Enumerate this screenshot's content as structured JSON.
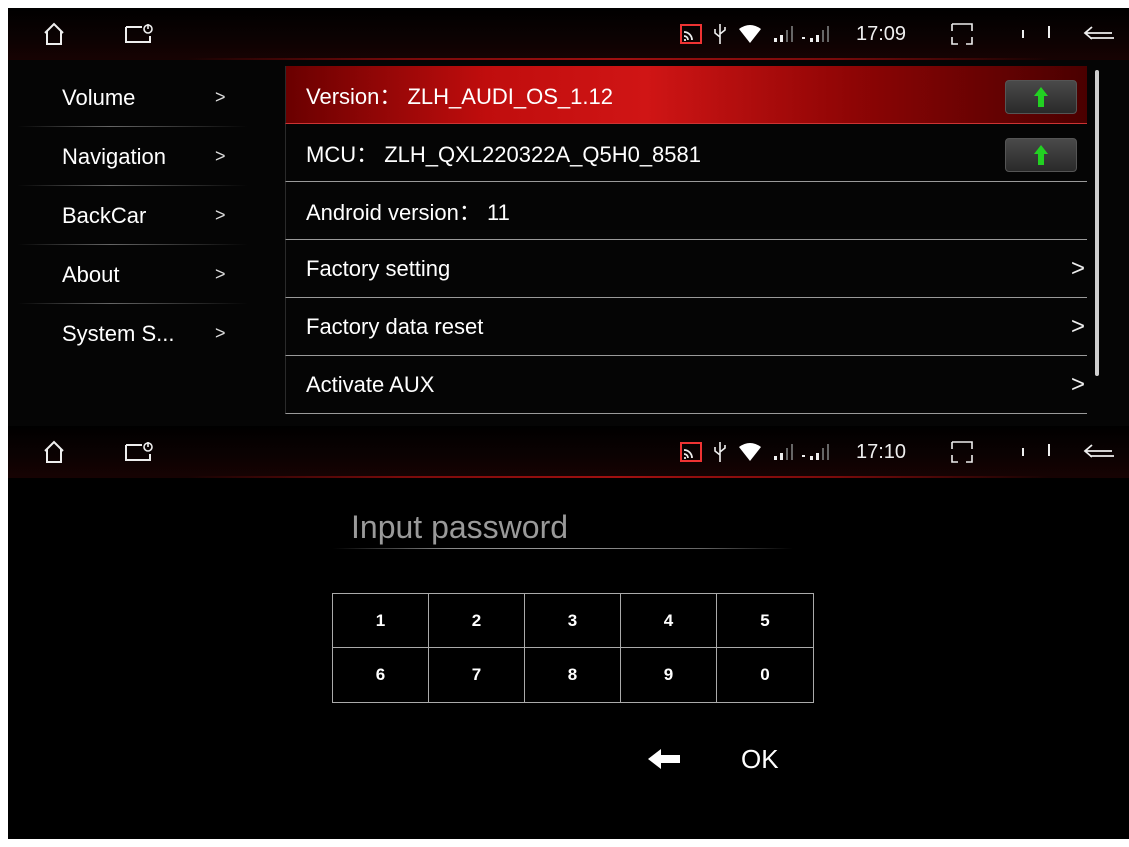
{
  "top_screen": {
    "status": {
      "time": "17:09"
    },
    "sidebar": [
      {
        "label": "Volume",
        "arrow": ">"
      },
      {
        "label": "Navigation",
        "arrow": ">"
      },
      {
        "label": "BackCar",
        "arrow": ">"
      },
      {
        "label": "About",
        "arrow": ">"
      },
      {
        "label": "System S...",
        "arrow": ">"
      }
    ],
    "rows": [
      {
        "label": "Version： ZLH_AUDI_OS_1.12"
      },
      {
        "label": "MCU： ZLH_QXL220322A_Q5H0_8581"
      },
      {
        "label": "Android version： 11"
      },
      {
        "label": "Factory setting",
        "chevron": ">"
      },
      {
        "label": "Factory data reset",
        "chevron": ">"
      },
      {
        "label": "Activate AUX",
        "chevron": ">"
      }
    ]
  },
  "bottom_screen": {
    "status": {
      "time": "17:10"
    },
    "password_title": "Input password",
    "keys": [
      "1",
      "2",
      "3",
      "4",
      "5",
      "6",
      "7",
      "8",
      "9",
      "0"
    ],
    "ok_label": "OK"
  },
  "colors": {
    "active_row": "#c00d0d",
    "update_arrow": "#22d022",
    "accent_line": "#a01010"
  },
  "icons": [
    "home-icon",
    "recent-apps-icon",
    "cast-icon",
    "usb-icon",
    "wifi-icon",
    "signal-icon",
    "expand-icon",
    "volume-icon",
    "back-icon",
    "upload-arrow-icon",
    "backspace-icon"
  ]
}
